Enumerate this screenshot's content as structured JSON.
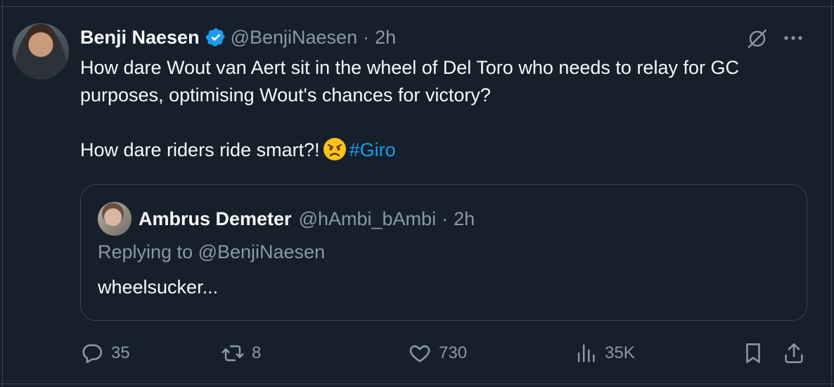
{
  "tweet": {
    "author_name": "Benji Naesen",
    "handle": "@BenjiNaesen",
    "separator": "·",
    "time": "2h",
    "line1": "How dare Wout van Aert sit in the wheel of Del Toro who needs to relay for GC purposes, optimising Wout's chances for victory?",
    "line2": "How dare riders ride smart?!",
    "hashtag": "#Giro"
  },
  "quote": {
    "author_name": "Ambrus Demeter",
    "handle": "@hAmbi_bAmbi",
    "separator": "·",
    "time": "2h",
    "replying": "Replying to @BenjiNaesen",
    "text": "wheelsucker..."
  },
  "actions": {
    "replies": "35",
    "reposts": "8",
    "likes": "730",
    "views": "35K"
  },
  "colors": {
    "background": "#15202b",
    "text": "#f7f9f9",
    "muted": "#8b98a5",
    "accent": "#1d9bf0",
    "border": "#38444d"
  },
  "icons": [
    "verified-icon",
    "grok-icon",
    "more-icon",
    "angry-emoji-icon",
    "reply-icon",
    "repost-icon",
    "like-icon",
    "views-icon",
    "bookmark-icon",
    "share-icon"
  ]
}
